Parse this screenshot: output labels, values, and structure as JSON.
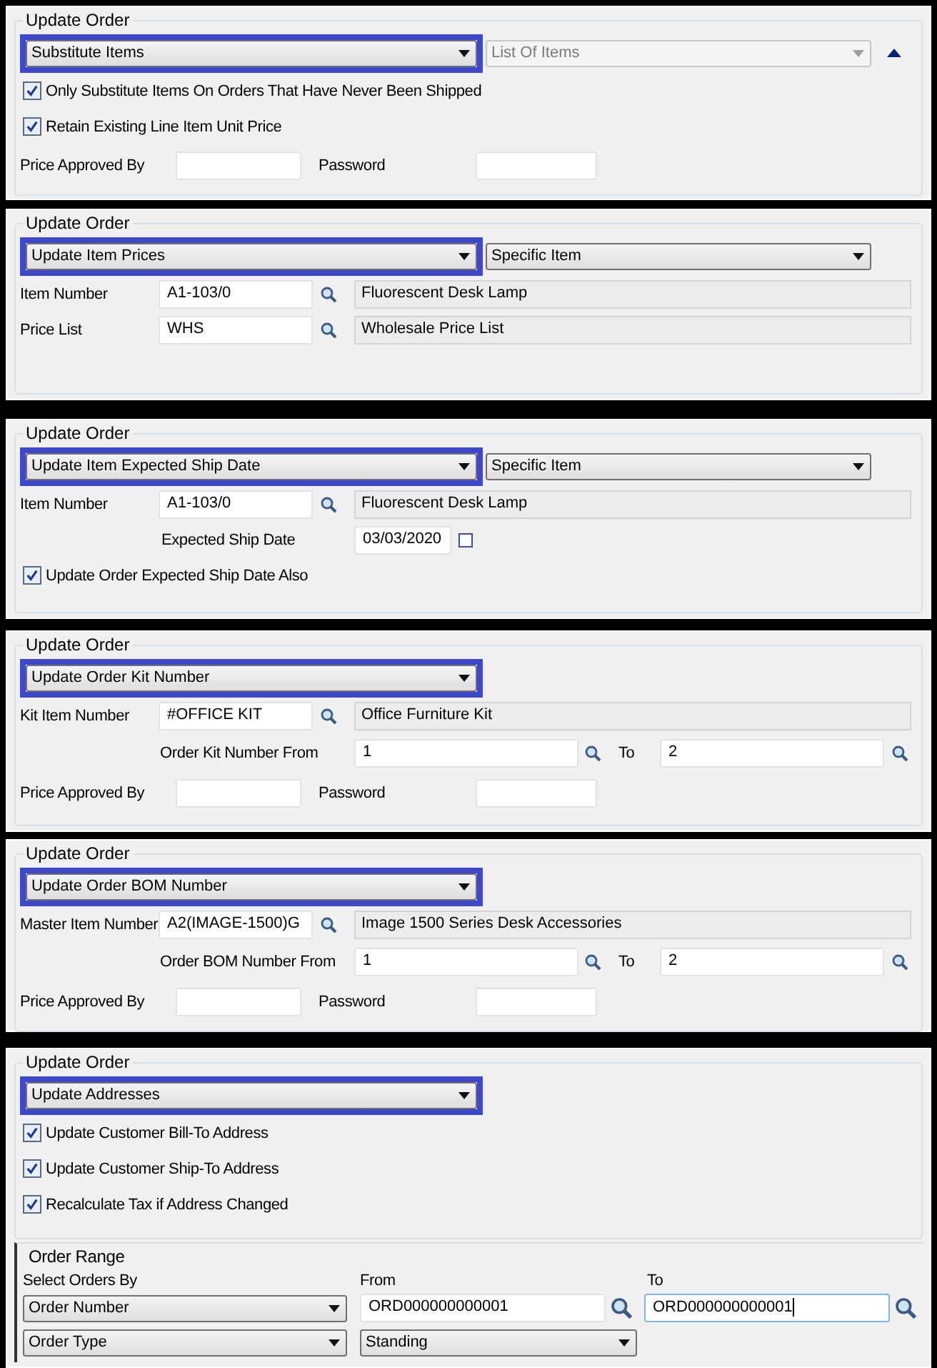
{
  "panels": [
    {
      "legend": "Update Order",
      "rows": [
        {
          "kind": "select",
          "value": "Substitute Items",
          "secondary": {
            "value": "List Of Items",
            "disabled": true
          },
          "collapse": true
        },
        {
          "kind": "check",
          "label": "Only Substitute Items On Orders That Have Never Been Shipped",
          "checked": true
        },
        {
          "kind": "check",
          "label": "Retain Existing Line Item Unit Price",
          "checked": true
        },
        {
          "kind": "approval",
          "fields": [
            {
              "label": "Price Approved By"
            },
            {
              "label": "Password"
            }
          ]
        }
      ]
    },
    {
      "legend": "Update Order",
      "rows": [
        {
          "kind": "select",
          "value": "Update Item Prices",
          "secondary": {
            "value": "Specific Item",
            "disabled": false
          }
        },
        {
          "kind": "lookup",
          "label": "Item Number",
          "value": "A1-103/0",
          "description": "Fluorescent Desk Lamp"
        },
        {
          "kind": "lookup",
          "label": "Price List",
          "value": "WHS",
          "description": "Wholesale Price List"
        }
      ]
    },
    {
      "legend": "Update Order",
      "rows": [
        {
          "kind": "select",
          "value": "Update Item Expected Ship Date",
          "secondary": {
            "value": "Specific Item",
            "disabled": false
          }
        },
        {
          "kind": "lookup",
          "label": "Item Number",
          "value": "A1-103/0",
          "description": "Fluorescent Desk Lamp"
        },
        {
          "kind": "date",
          "label": "Expected Ship Date",
          "value": "03/03/2020"
        },
        {
          "kind": "check",
          "label": "Update Order Expected Ship Date Also",
          "checked": true
        }
      ]
    },
    {
      "legend": "Update Order",
      "rows": [
        {
          "kind": "select",
          "value": "Update Order Kit Number"
        },
        {
          "kind": "lookup",
          "label": "Kit Item Number",
          "value": "#OFFICE KIT",
          "description": "Office Furniture Kit"
        },
        {
          "kind": "range",
          "label": "Order Kit Number From",
          "from": "1",
          "to_label": "To",
          "to": "2"
        },
        {
          "kind": "approval",
          "fields": [
            {
              "label": "Price Approved By"
            },
            {
              "label": "Password"
            }
          ]
        }
      ]
    },
    {
      "legend": "Update Order",
      "rows": [
        {
          "kind": "select",
          "value": "Update Order BOM Number"
        },
        {
          "kind": "lookup",
          "label": "Master Item Number",
          "value": "A2(IMAGE-1500)G",
          "description": "Image 1500 Series Desk Accessories"
        },
        {
          "kind": "range",
          "label": "Order BOM Number From",
          "from": "1",
          "to_label": "To",
          "to": "2"
        },
        {
          "kind": "approval",
          "fields": [
            {
              "label": "Price Approved By"
            },
            {
              "label": "Password"
            }
          ]
        }
      ]
    },
    {
      "legend": "Update Order",
      "rows": [
        {
          "kind": "select",
          "value": "Update Addresses"
        },
        {
          "kind": "check",
          "label": "Update Customer Bill-To Address",
          "checked": true
        },
        {
          "kind": "check",
          "label": "Update Customer Ship-To Address",
          "checked": true
        },
        {
          "kind": "check",
          "label": "Recalculate Tax if Address Changed",
          "checked": true
        }
      ],
      "order_range": {
        "legend": "Order Range",
        "headings": [
          "Select Orders By",
          "From",
          "To"
        ],
        "rows": [
          {
            "kind": "range",
            "select": "Order Number",
            "from": "ORD000000000001",
            "to": "ORD000000000001"
          },
          {
            "kind": "choice",
            "select": "Order Type",
            "value": "Standing"
          }
        ]
      }
    }
  ]
}
